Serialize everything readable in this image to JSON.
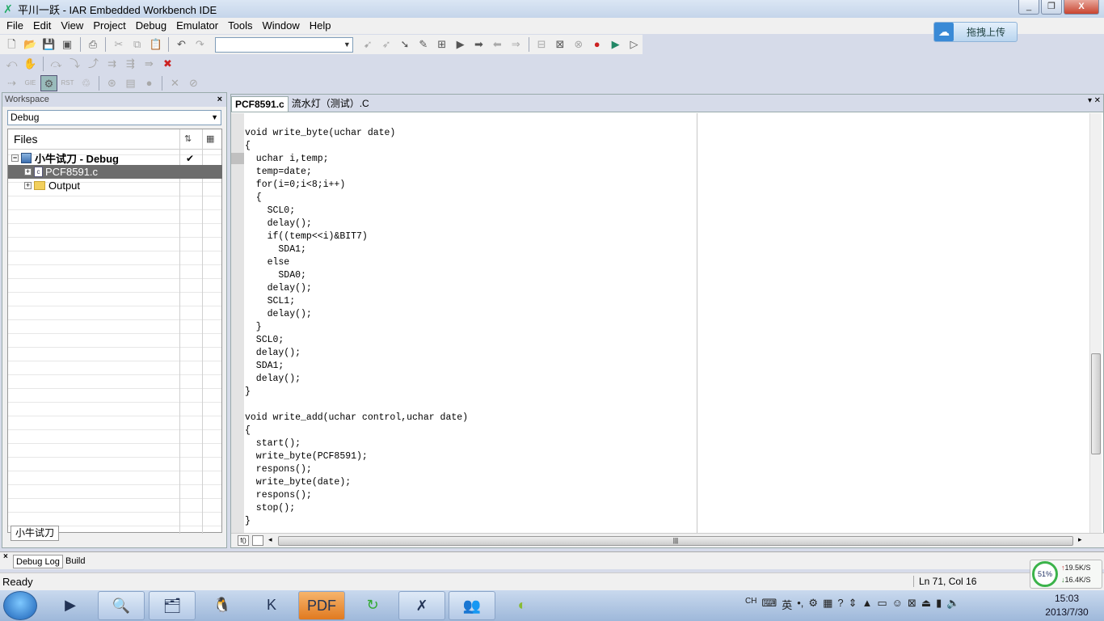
{
  "window": {
    "title": "平川一跃 - IAR Embedded Workbench IDE",
    "app_icon": "iar-icon",
    "buttons": [
      "_",
      "❐",
      "X"
    ]
  },
  "menubar": {
    "items": [
      "File",
      "Edit",
      "View",
      "Project",
      "Debug",
      "Emulator",
      "Tools",
      "Window",
      "Help"
    ]
  },
  "upload_button": {
    "label": "拖拽上传"
  },
  "workspace": {
    "header": "Workspace",
    "config": "Debug",
    "files_label": "Files",
    "project": "小牛试刀 - Debug",
    "items": [
      "PCF8591.c",
      "Output"
    ],
    "bottom_tab": "小牛试刀"
  },
  "editor": {
    "tabs": [
      "PCF8591.c",
      "流水灯（测试）.C"
    ],
    "lines": [
      "void write_byte(uchar date)",
      "{",
      "  uchar i,temp;",
      "  temp=date;",
      "  for(i=0;i<8;i++)",
      "  {",
      "    SCL0;",
      "    delay();",
      "    if((temp<<i)&BIT7)",
      "      SDA1;",
      "    else",
      "      SDA0;",
      "    delay();",
      "    SCL1;",
      "    delay();",
      "  }",
      "  SCL0;",
      "  delay();",
      "  SDA1;",
      "  delay();",
      "}",
      "",
      "void write_add(uchar control,uchar date)",
      "{",
      "  start();",
      "  write_byte(PCF8591);",
      "  respons();",
      "  write_byte(date);",
      "  respons();",
      "  stop();",
      "}"
    ]
  },
  "log_tabs": [
    "Debug Log",
    "Build"
  ],
  "status": {
    "ready": "Ready",
    "position": "Ln 71, Col 16"
  },
  "netmon": {
    "percent": "51%",
    "up": "19.5K/S",
    "down": "16.4K/S"
  },
  "tray": {
    "lang": "CH",
    "ime": "英"
  },
  "clock": {
    "time": "15:03",
    "date": "2013/7/30"
  }
}
